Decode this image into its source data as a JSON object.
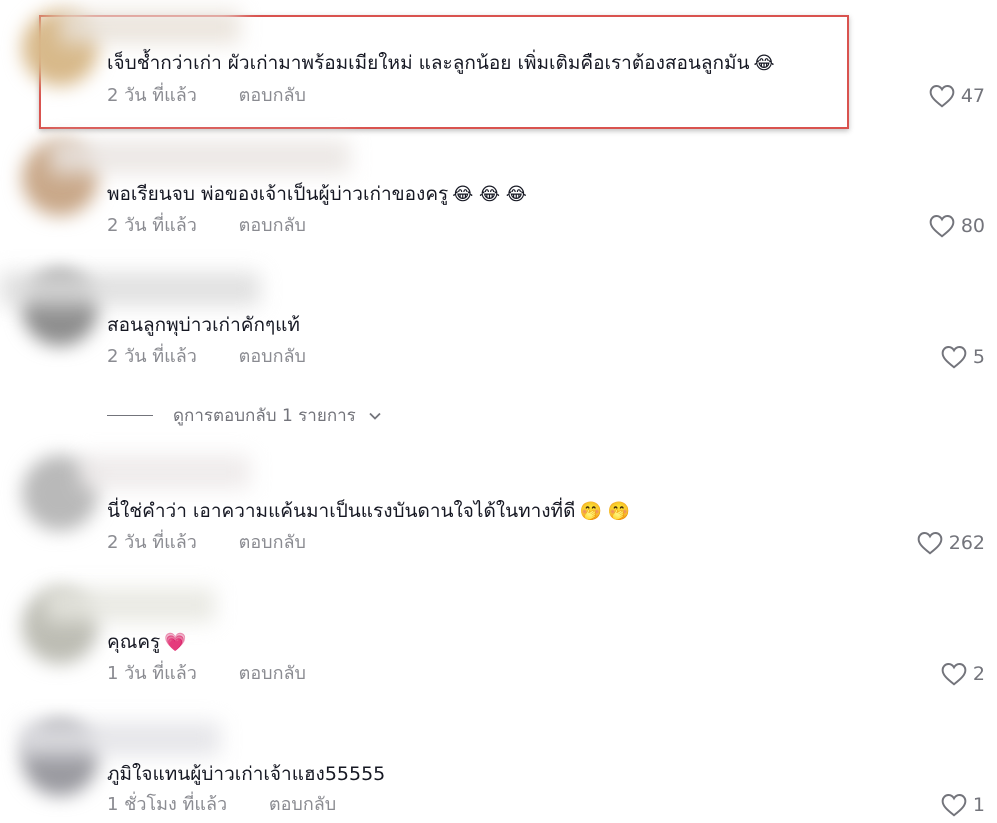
{
  "comments": [
    {
      "text": "เจ็บช้ำกว่าเก่า ผัวเก่ามาพร้อมเมียใหม่ และลูกน้อย เพิ่มเติมคือเราต้องสอนลูกมัน",
      "emoji": "😂",
      "time": "2 วัน ที่แล้ว",
      "reply": "ตอบกลับ",
      "likes": "47"
    },
    {
      "text": "พอเรียนจบ พ่อของเจ้าเป็นผู้บ่าวเก่าของครู",
      "emoji": "😂 😂 😂",
      "time": "2 วัน ที่แล้ว",
      "reply": "ตอบกลับ",
      "likes": "80"
    },
    {
      "text": "สอนลูกพุบ่าวเก่าคักๆแท้",
      "emoji": "",
      "time": "2 วัน ที่แล้ว",
      "reply": "ตอบกลับ",
      "likes": "5"
    },
    {
      "text": "นี่ใช่คำว่า เอาความแค้นมาเป็นแรงบันดานใจได้ในทางที่ดี",
      "emoji": "🤭 🤭",
      "time": "2 วัน ที่แล้ว",
      "reply": "ตอบกลับ",
      "likes": "262"
    },
    {
      "text": "คุณครู",
      "emoji": "💗",
      "time": "1 วัน ที่แล้ว",
      "reply": "ตอบกลับ",
      "likes": "2"
    },
    {
      "text": "ภูมิใจแทนผู้บ่าวเก่าเจ้าแฮง55555",
      "emoji": "",
      "time": "1 ชั่วโมง ที่แล้ว",
      "reply": "ตอบกลับ",
      "likes": "1"
    }
  ],
  "view_replies": {
    "label": "ดูการตอบกลับ 1 รายการ"
  },
  "colors": {
    "highlight_border": "#d9534f",
    "text": "#161823",
    "meta": "#8a8b91"
  }
}
